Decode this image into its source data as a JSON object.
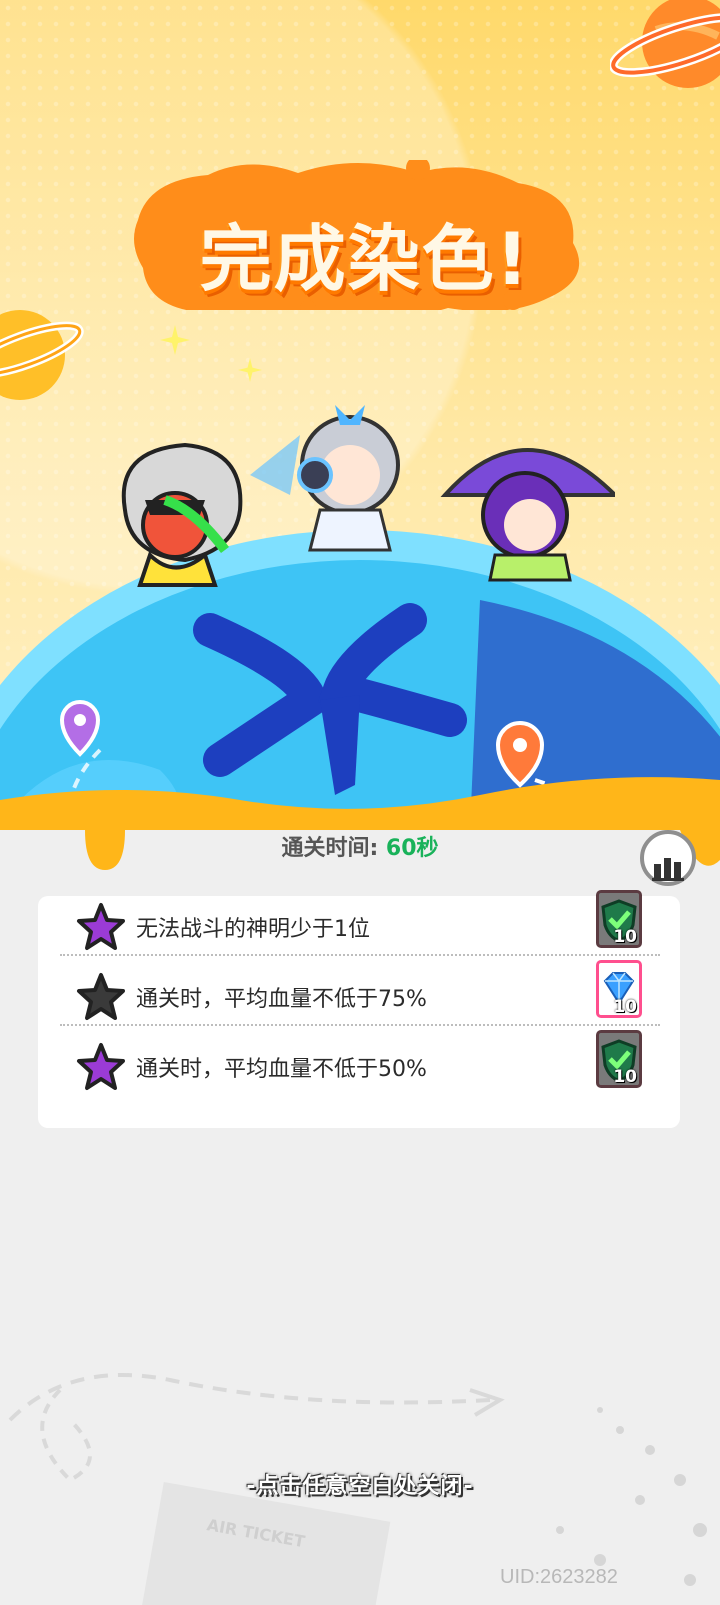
{
  "title": "完成染色!",
  "clear_time": {
    "label": "通关时间:",
    "value": "60秒"
  },
  "objectives": [
    {
      "text": "无法战斗的神明少于1位",
      "star": "purple-star-icon",
      "reward": "shield-token-icon",
      "reward_count": "10"
    },
    {
      "text": "通关时，平均血量不低于75%",
      "star": "grey-star-icon",
      "reward": "blue-gem-icon",
      "reward_count": "10"
    },
    {
      "text": "通关时，平均血量不低于50%",
      "star": "purple-star-icon",
      "reward": "shield-token-icon",
      "reward_count": "10"
    }
  ],
  "close_hint": "-点击任意空白处关闭-",
  "uid": "UID:2623282",
  "decor_text": "AIR TICKET",
  "colors": {
    "time_value": "#19b25a",
    "star_purple": "#9b3bd6",
    "star_grey": "#3a3a3a",
    "gem_border": "#ff4f8e"
  }
}
